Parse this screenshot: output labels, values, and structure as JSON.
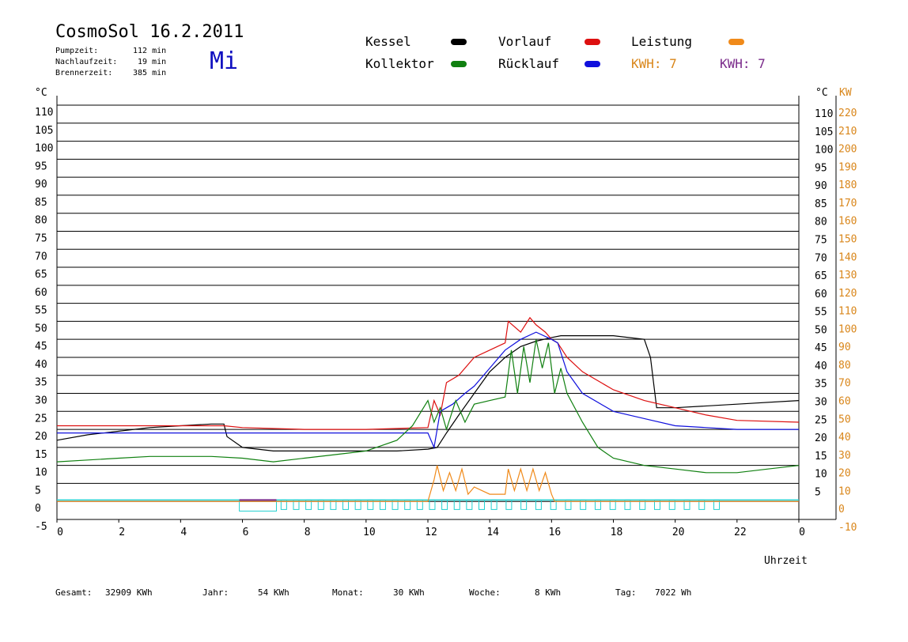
{
  "header": {
    "title": "CosmoSol 16.2.2011",
    "weekday": "Mi",
    "stats": [
      {
        "label": "Pumpzeit:",
        "value": "112 min"
      },
      {
        "label": "Nachlaufzeit:",
        "value": "19 min"
      },
      {
        "label": "Brennerzeit:",
        "value": "385 min"
      }
    ]
  },
  "legend": {
    "kessel": "Kessel",
    "vorlauf": "Vorlauf",
    "leistung": "Leistung",
    "kollektor": "Kollektor",
    "ruecklauf": "Rücklauf",
    "kwh1": "KWH: 7",
    "kwh2": "KWH: 7",
    "colors": {
      "kessel": "#000000",
      "vorlauf": "#dd1010",
      "leistung": "#f08a1a",
      "kollektor": "#108010",
      "ruecklauf": "#1010dd",
      "kwh1": "#d9861a",
      "kwh2": "#7a2a8a"
    }
  },
  "footer": {
    "gesamt_label": "Gesamt:",
    "gesamt_value": "32909 KWh",
    "jahr_label": "Jahr:",
    "jahr_value": "54 KWh",
    "monat_label": "Monat:",
    "monat_value": "30 KWh",
    "woche_label": "Woche:",
    "woche_value": "8 KWh",
    "tag_label": "Tag:",
    "tag_value": "7022 Wh"
  },
  "chart_data": {
    "type": "line",
    "xlabel": "Uhrzeit",
    "xlim": [
      0,
      24
    ],
    "ylim": [
      -5,
      110
    ],
    "y2lim": [
      -10,
      220
    ],
    "ylabel": "°C",
    "y2label_left": "°C",
    "y2label_right": "KW",
    "x_ticks": [
      "0",
      "2",
      "4",
      "6",
      "8",
      "10",
      "12",
      "14",
      "16",
      "18",
      "20",
      "22",
      "0"
    ],
    "y_ticks": [
      -5,
      0,
      5,
      10,
      15,
      20,
      25,
      30,
      35,
      40,
      45,
      50,
      55,
      60,
      65,
      70,
      75,
      80,
      85,
      90,
      95,
      100,
      105,
      110
    ],
    "y2_ticks": [
      -10,
      0,
      10,
      20,
      30,
      40,
      50,
      60,
      70,
      80,
      90,
      100,
      110,
      120,
      130,
      140,
      150,
      160,
      170,
      180,
      190,
      200,
      210,
      220
    ],
    "right_inner_ticks": [
      5,
      10,
      15,
      20,
      25,
      30,
      35,
      40,
      45,
      50,
      55,
      60,
      65,
      70,
      75,
      80,
      85,
      90,
      95,
      100,
      105,
      110
    ],
    "grid": true,
    "series": [
      {
        "name": "Kessel",
        "color": "#000000",
        "x": [
          0,
          1,
          2,
          3,
          4,
          5,
          5.4,
          5.5,
          6,
          7,
          8,
          9,
          10,
          11,
          12,
          12.3,
          12.6,
          13,
          13.5,
          14,
          14.5,
          15,
          15.5,
          16,
          16.3,
          17,
          18,
          19,
          19.2,
          19.4,
          20,
          22,
          24
        ],
        "y": [
          17,
          18.5,
          19.5,
          20.5,
          21,
          21.5,
          21.5,
          18,
          15,
          14,
          14,
          14,
          14,
          14,
          14.5,
          15,
          19,
          24,
          30,
          36,
          40,
          43,
          44.5,
          45.5,
          46,
          46,
          46,
          45,
          40,
          26,
          26,
          27,
          28
        ]
      },
      {
        "name": "Vorlauf",
        "color": "#dd1010",
        "x": [
          0,
          2,
          4,
          5.4,
          6,
          8,
          10,
          12,
          12.2,
          12.4,
          12.6,
          13,
          13.5,
          14,
          14.5,
          14.6,
          15,
          15.3,
          15.5,
          15.8,
          16,
          16.2,
          16.5,
          17,
          18,
          19,
          20,
          21,
          22,
          24
        ],
        "y": [
          21,
          21,
          21,
          21,
          20.5,
          20,
          20,
          20.5,
          28,
          24,
          33,
          35,
          40,
          42,
          44,
          50,
          47,
          51,
          49,
          47,
          45,
          44,
          40,
          36,
          31,
          28,
          26,
          24,
          22.5,
          22
        ]
      },
      {
        "name": "Rücklauf",
        "color": "#1010dd",
        "x": [
          0,
          2,
          4,
          6,
          8,
          10,
          12,
          12.2,
          12.4,
          12.8,
          13.2,
          13.5,
          14,
          14.5,
          15,
          15.5,
          16,
          16.2,
          16.5,
          17,
          18,
          19,
          20,
          21,
          22,
          24
        ],
        "y": [
          19,
          19,
          19,
          19,
          19,
          19,
          19,
          15,
          25,
          27,
          30,
          32,
          37,
          42,
          45,
          47,
          45,
          44,
          36,
          30,
          25,
          23,
          21,
          20.5,
          20,
          20
        ]
      },
      {
        "name": "Kollektor",
        "color": "#108010",
        "x": [
          0,
          1,
          2,
          3,
          4,
          5,
          6,
          7,
          8,
          9,
          10,
          11,
          11.5,
          12,
          12.2,
          12.4,
          12.6,
          12.9,
          13.2,
          13.5,
          14,
          14.5,
          14.7,
          14.9,
          15.1,
          15.3,
          15.5,
          15.7,
          15.9,
          16.1,
          16.3,
          16.5,
          17,
          17.5,
          18,
          19,
          20,
          21,
          22,
          23,
          24
        ],
        "y": [
          11,
          11.5,
          12,
          12.5,
          12.5,
          12.5,
          12,
          11,
          12,
          13,
          14,
          17,
          21,
          28,
          22,
          26,
          20,
          28,
          22,
          27,
          28,
          29,
          42,
          30,
          43,
          33,
          45,
          37,
          44,
          30,
          37,
          30,
          22,
          15,
          12,
          10,
          9,
          8,
          8,
          9,
          10
        ]
      },
      {
        "name": "Leistung",
        "color": "#f08a1a",
        "x": [
          0,
          12,
          12.2,
          12.3,
          12.5,
          12.7,
          12.9,
          13.1,
          13.3,
          13.5,
          14,
          14.5,
          14.6,
          14.8,
          15,
          15.2,
          15.4,
          15.6,
          15.8,
          16,
          16.1,
          24
        ],
        "y": [
          0,
          0,
          6,
          10,
          3,
          8,
          3,
          9,
          2,
          4,
          2,
          2,
          9,
          3,
          9,
          3,
          9,
          3,
          8,
          2,
          0,
          0
        ]
      }
    ]
  }
}
